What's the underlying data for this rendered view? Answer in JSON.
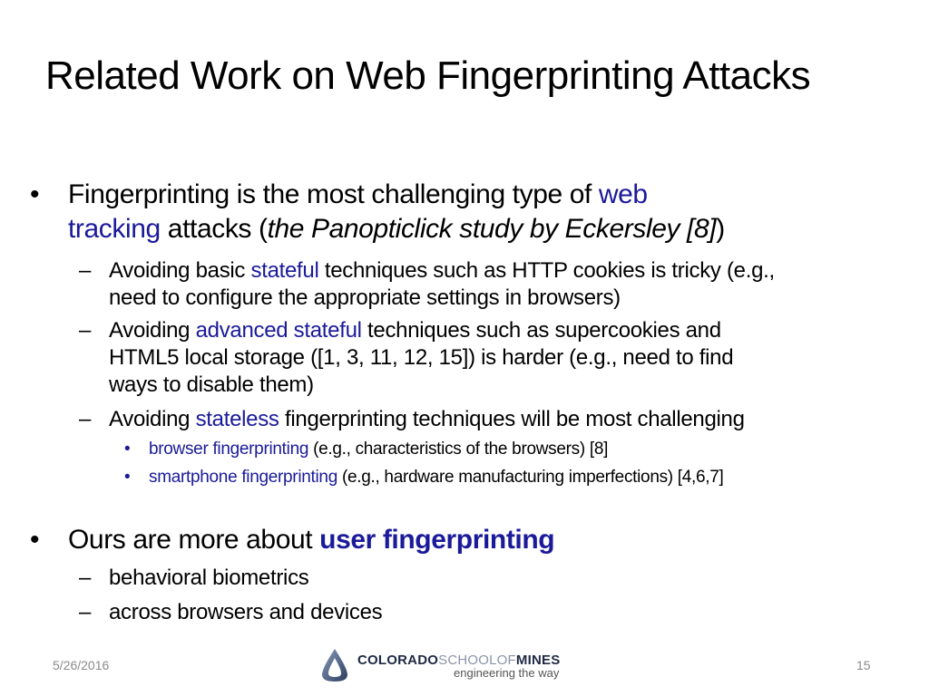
{
  "slide": {
    "title": "Related Work on Web Fingerprinting Attacks",
    "bullets": {
      "b1": {
        "t1": "Fingerprinting is the most challenging type of ",
        "t2": "web",
        "t3": "tracking",
        "t4": " attacks (",
        "t5": "the Panopticlick study by Eckersley [8]",
        "t6": ")"
      },
      "s1": {
        "t1": "Avoiding basic ",
        "t2": "stateful",
        "t3": " techniques such as HTTP cookies is tricky (e.g.,",
        "t4": "need to configure the appropriate settings in browsers)"
      },
      "s2": {
        "t1": "Avoiding ",
        "t2": "advanced stateful",
        "t3": " techniques such as supercookies and",
        "t4": "HTML5 local storage ([1, 3, 11, 12, 15]) is harder (e.g., need to find",
        "t5": "ways to disable them)"
      },
      "s3": {
        "t1": "Avoiding ",
        "t2": "stateless",
        "t3": " fingerprinting techniques will be most challenging"
      },
      "ss1": {
        "t1": "browser fingerprinting",
        "t2": " (e.g., characteristics of the browsers) [8]"
      },
      "ss2": {
        "t1": "smartphone fingerprinting",
        "t2": " (e.g., hardware manufacturing imperfections) [4,6,7]"
      },
      "b2": {
        "t1": "Ours are more about ",
        "t2": "user fingerprinting"
      },
      "s4": {
        "t1": "behavioral biometrics"
      },
      "s5": {
        "t1": "across browsers and devices"
      }
    },
    "symbols": {
      "bullet": "•",
      "dash": "–"
    }
  },
  "footer": {
    "date": "5/26/2016",
    "page": "15",
    "logo": {
      "part1": "COLORADO",
      "part2": "SCHOOLOF",
      "part3": "MINES",
      "tagline": "engineering the way"
    }
  }
}
